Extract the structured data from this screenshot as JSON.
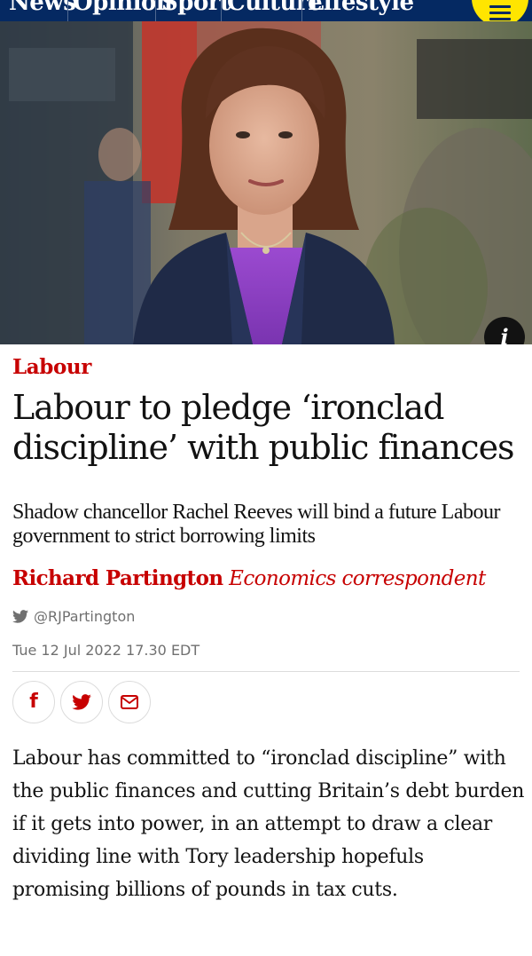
{
  "nav": {
    "items": [
      "News",
      "Opinion",
      "Sport",
      "Culture",
      "Lifestyle"
    ],
    "menu_icon": "hamburger-icon"
  },
  "hero": {
    "info_label": "i",
    "colors": {
      "blazer": "#1f2a47",
      "top": "#8a3fbf",
      "hair": "#5a2f1c",
      "banner": "#c0362c"
    }
  },
  "article": {
    "kicker": "Labour",
    "headline": "Labour to pledge ‘ironclad discipline’ with public finances",
    "standfirst": "Shadow chancellor Rachel Reeves will bind a future Labour government to strict borrowing limits",
    "author": "Richard Partington",
    "author_role": "Economics correspondent",
    "twitter_handle": "@RJPartington",
    "date": "Tue 12 Jul 2022 17.30 EDT",
    "body": "Labour has committed to “ironclad discipline” with the public finances and cutting Britain’s debt burden if it gets into power, in an attempt to draw a clear dividing line with Tory leadership hopefuls promising billions of pounds in tax cuts."
  },
  "share": {
    "facebook_label": "f",
    "icons": [
      "facebook-icon",
      "twitter-icon",
      "email-icon"
    ]
  },
  "colors": {
    "brand_navy": "#052962",
    "menu_yellow": "#ffe500",
    "news_red": "#c70000",
    "meta_grey": "#707070"
  }
}
